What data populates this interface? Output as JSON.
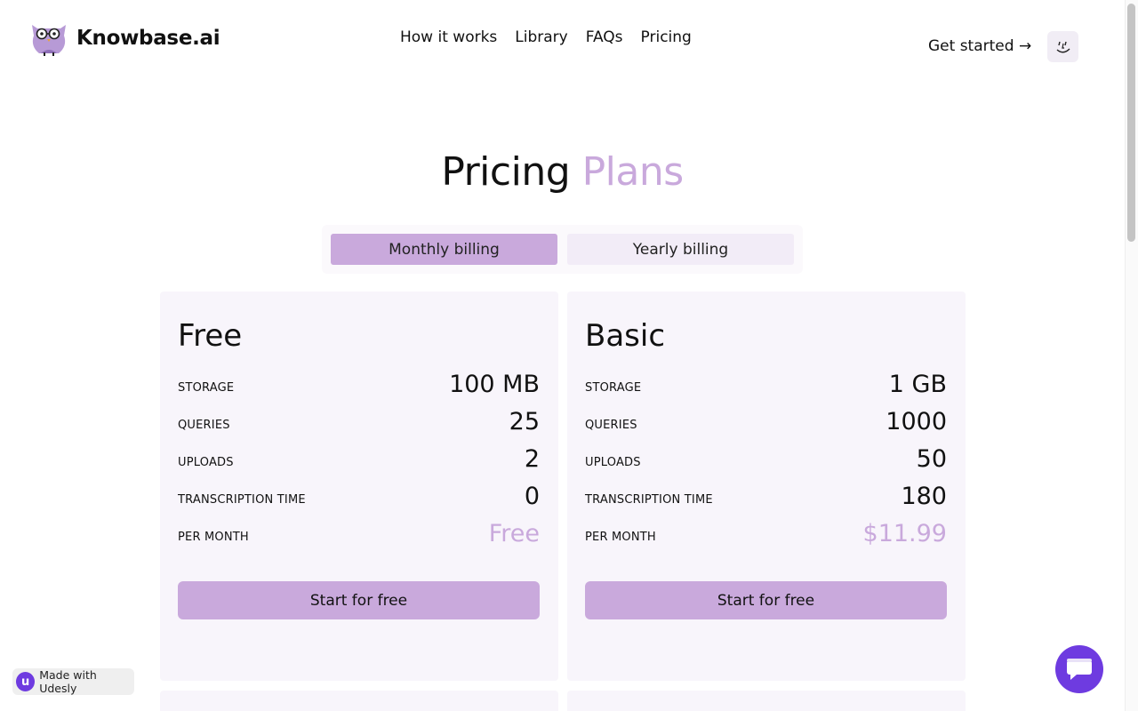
{
  "header": {
    "brand": "Knowbase.ai",
    "nav": [
      "How it works",
      "Library",
      "FAQs",
      "Pricing"
    ],
    "get_started": "Get started →",
    "avatar_icon": "face-emoji-icon"
  },
  "hero": {
    "title_main": "Pricing",
    "title_accent": "Plans",
    "accent_color": "#c9a9dc"
  },
  "billing_toggle": {
    "monthly": "Monthly billing",
    "yearly": "Yearly billing",
    "selected": "Monthly billing"
  },
  "plans": [
    {
      "name": "Free",
      "rows": [
        {
          "label": "STORAGE",
          "value": "100 MB"
        },
        {
          "label": "QUERIES",
          "value": "25"
        },
        {
          "label": "UPLOADS",
          "value": "2"
        },
        {
          "label": "TRANSCRIPTION TIME",
          "value": "0"
        },
        {
          "label": "PER MONTH",
          "value": "Free"
        }
      ],
      "cta": "Start for free"
    },
    {
      "name": "Basic",
      "rows": [
        {
          "label": "STORAGE",
          "value": "1 GB"
        },
        {
          "label": "QUERIES",
          "value": "1000"
        },
        {
          "label": "UPLOADS",
          "value": "50"
        },
        {
          "label": "TRANSCRIPTION TIME",
          "value": "180"
        },
        {
          "label": "PER MONTH",
          "value": "$11.99"
        }
      ],
      "cta": "Start for free"
    }
  ],
  "footer_badge": {
    "text": "Made with Udesly",
    "logo_letter": "u"
  },
  "chat_widget": {
    "icon": "chat-bubble-icon",
    "color": "#6e3be0"
  }
}
